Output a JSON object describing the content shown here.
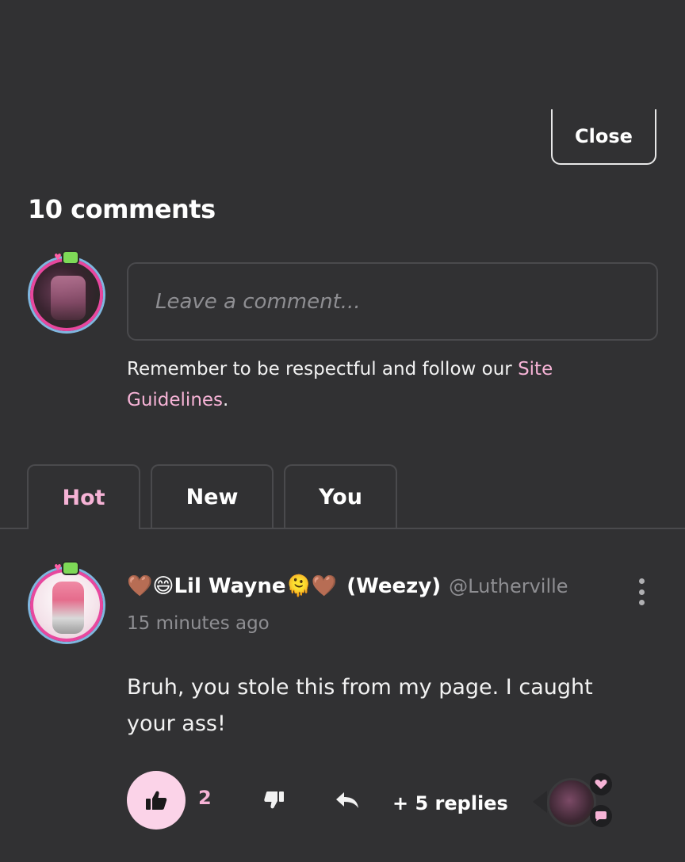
{
  "header": {
    "close_label": "Close"
  },
  "comments_section": {
    "title": "10 comments",
    "input_placeholder": "Leave a comment...",
    "guidelines_prefix": "Remember to be respectful and follow our ",
    "guidelines_link": "Site Guidelines",
    "guidelines_suffix": "."
  },
  "tabs": [
    {
      "label": "Hot",
      "active": true
    },
    {
      "label": "New",
      "active": false
    },
    {
      "label": "You",
      "active": false
    }
  ],
  "comment": {
    "author_emoji_prefix": "🤎😄",
    "author_name": "Lil Wayne",
    "author_emoji_suffix": "🫠🤎",
    "author_nickname": "(Weezy)",
    "author_handle": "@Lutherville",
    "timestamp": "15 minutes ago",
    "body": "Bruh, you stole this from my page. I caught your ass!",
    "like_count": "2",
    "replies_label": "+ 5 replies"
  },
  "icons": {
    "like": "thumbs-up-icon",
    "dislike": "thumbs-down-icon",
    "reply": "reply-arrow-icon",
    "more": "kebab-menu-icon",
    "heart": "heart-icon",
    "chat": "chat-bubble-icon"
  },
  "colors": {
    "background": "#313133",
    "accent_pink": "#f6b3d6",
    "like_button_bg": "#fbd3e8",
    "avatar_ring": "#e8479e",
    "muted_text": "#8e8e92"
  }
}
